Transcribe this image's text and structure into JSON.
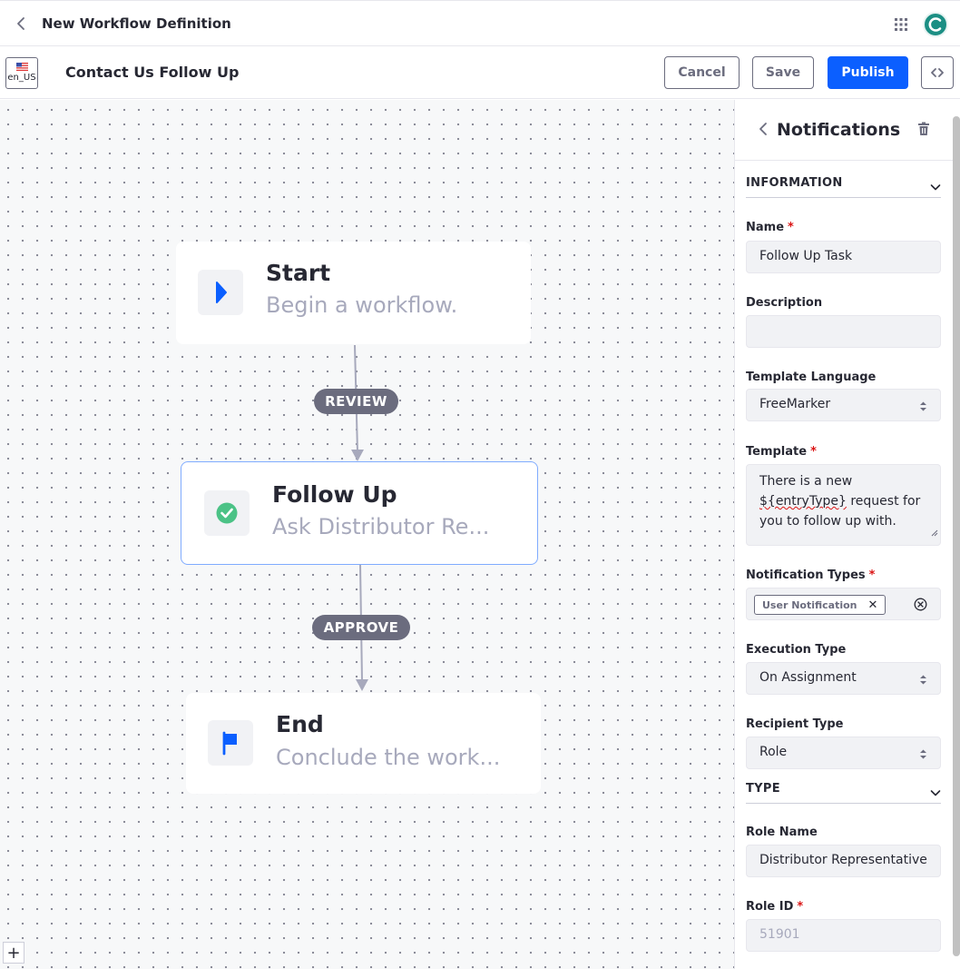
{
  "header": {
    "title": "New Workflow Definition"
  },
  "toolbar": {
    "locale": "en_US",
    "definition_name": "Contact Us Follow Up",
    "cancel_label": "Cancel",
    "save_label": "Save",
    "publish_label": "Publish",
    "code_label": "<>"
  },
  "canvas": {
    "nodes": [
      {
        "title": "Start",
        "description": "Begin a workflow."
      },
      {
        "title": "Follow Up",
        "description": "Ask Distributor Re..."
      },
      {
        "title": "End",
        "description": "Conclude the work..."
      }
    ],
    "transitions": [
      "REVIEW",
      "APPROVE"
    ],
    "zoom_in_label": "+"
  },
  "sidebar": {
    "title": "Notifications",
    "information_section": "INFORMATION",
    "type_section": "TYPE",
    "fields": {
      "name": {
        "label": "Name",
        "value": "Follow Up Task"
      },
      "description": {
        "label": "Description",
        "value": ""
      },
      "template_language": {
        "label": "Template Language",
        "value": "FreeMarker"
      },
      "template": {
        "label": "Template",
        "line1": "There is a new",
        "line2_var": "${entryType}",
        "line2_rest": " request for",
        "line3": "you to follow up with."
      },
      "notification_types": {
        "label": "Notification Types",
        "tag": "User Notification"
      },
      "execution_type": {
        "label": "Execution Type",
        "value": "On Assignment"
      },
      "recipient_type": {
        "label": "Recipient Type",
        "value": "Role"
      },
      "role_name": {
        "label": "Role Name",
        "value": "Distributor Representative"
      },
      "role_id": {
        "label": "Role ID",
        "value": "51901"
      }
    },
    "required_marker": "*"
  },
  "colors": {
    "primary": "#0b5fff",
    "success": "#4bc286",
    "flow": "#a7a9bc",
    "pill": "#6b6c7e",
    "selected_border": "#80acff"
  },
  "icons": {
    "back": "chevron-left-icon",
    "apps": "grid-icon",
    "start": "play-icon",
    "task": "check-circle-icon",
    "end": "flag-icon",
    "delete": "trash-icon"
  }
}
